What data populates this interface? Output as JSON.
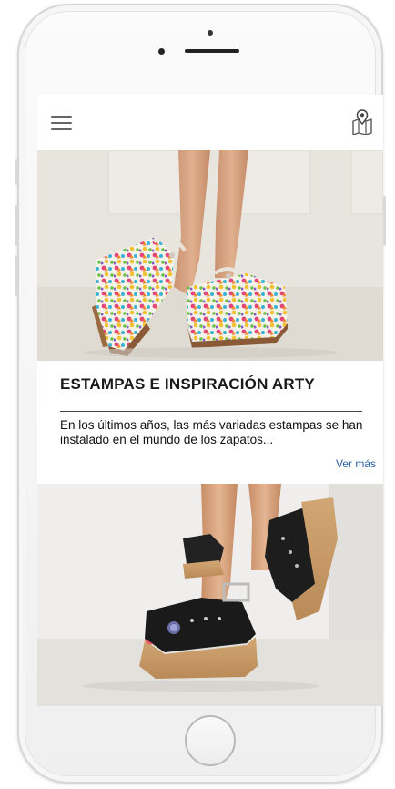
{
  "header": {
    "menu_icon": "hamburger-menu-icon",
    "map_icon": "map-pin-icon"
  },
  "article": {
    "title": "ESTAMPAS E INSPIRACIÓN ARTY",
    "excerpt": "En los últimos años, las más variadas estampas se han instalado en el mundo de los zapatos...",
    "more_label": "Ver más"
  },
  "colors": {
    "link": "#2b5fa8",
    "text": "#111111",
    "icon": "#666666"
  }
}
